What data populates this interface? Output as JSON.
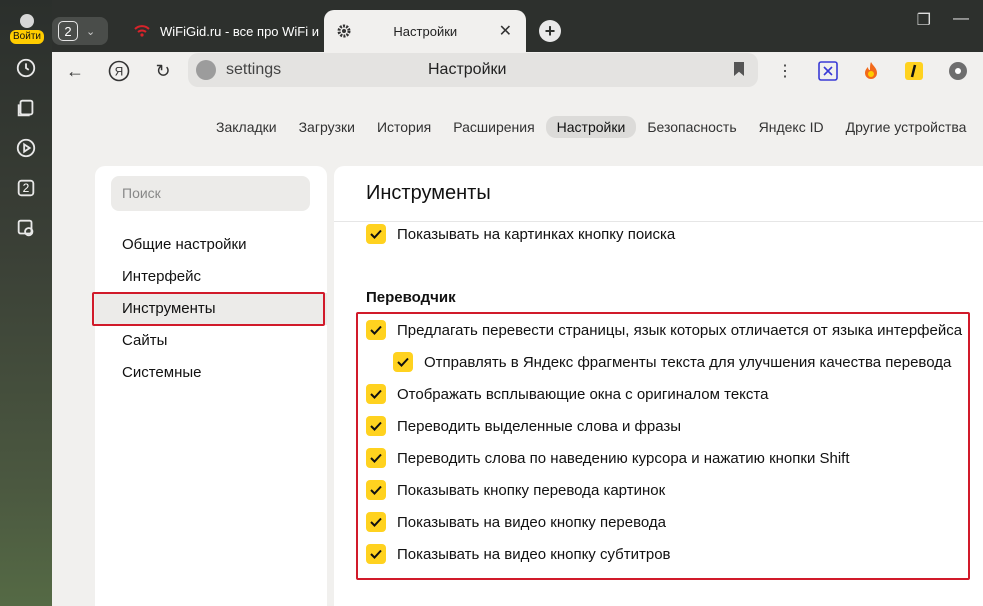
{
  "sidebar_strip": {
    "login_label": "Войти",
    "icons": [
      "history-icon",
      "collections-icon",
      "media-icon",
      "tabs-count-icon",
      "screenshot-icon"
    ],
    "tabs_count_icon_text": "2"
  },
  "tabs": {
    "count": "2",
    "tab1_title": "WiFiGid.ru - все про WiFi и",
    "tab2_title": "Настройки"
  },
  "toolbar": {
    "url": "settings",
    "page_title": "Настройки"
  },
  "top_nav": {
    "items": [
      "Закладки",
      "Загрузки",
      "История",
      "Расширения",
      "Настройки",
      "Безопасность",
      "Яндекс ID",
      "Другие устройства"
    ],
    "active": "Настройки"
  },
  "left_menu": {
    "search_placeholder": "Поиск",
    "items": [
      "Общие настройки",
      "Интерфейс",
      "Инструменты",
      "Сайты",
      "Системные"
    ],
    "active": "Инструменты"
  },
  "main": {
    "title": "Инструменты",
    "search_images_option": "Показывать на картинках кнопку поиска",
    "translator_heading": "Переводчик",
    "translator_options": [
      "Предлагать перевести страницы, язык которых отличается от языка интерфейса",
      "Отправлять в Яндекс фрагменты текста для улучшения качества перевода",
      "Отображать всплывающие окна с оригиналом текста",
      "Переводить выделенные слова и фразы",
      "Переводить слова по наведению курсора и нажатию кнопки Shift",
      "Показывать кнопку перевода картинок",
      "Показывать на видео кнопку перевода",
      "Показывать на видео кнопку субтитров"
    ],
    "all_checked": true
  },
  "colors": {
    "checkbox": "#ffd21f",
    "highlight_box": "#d11a2a",
    "active_tab_bg": "#f1f0ee"
  }
}
